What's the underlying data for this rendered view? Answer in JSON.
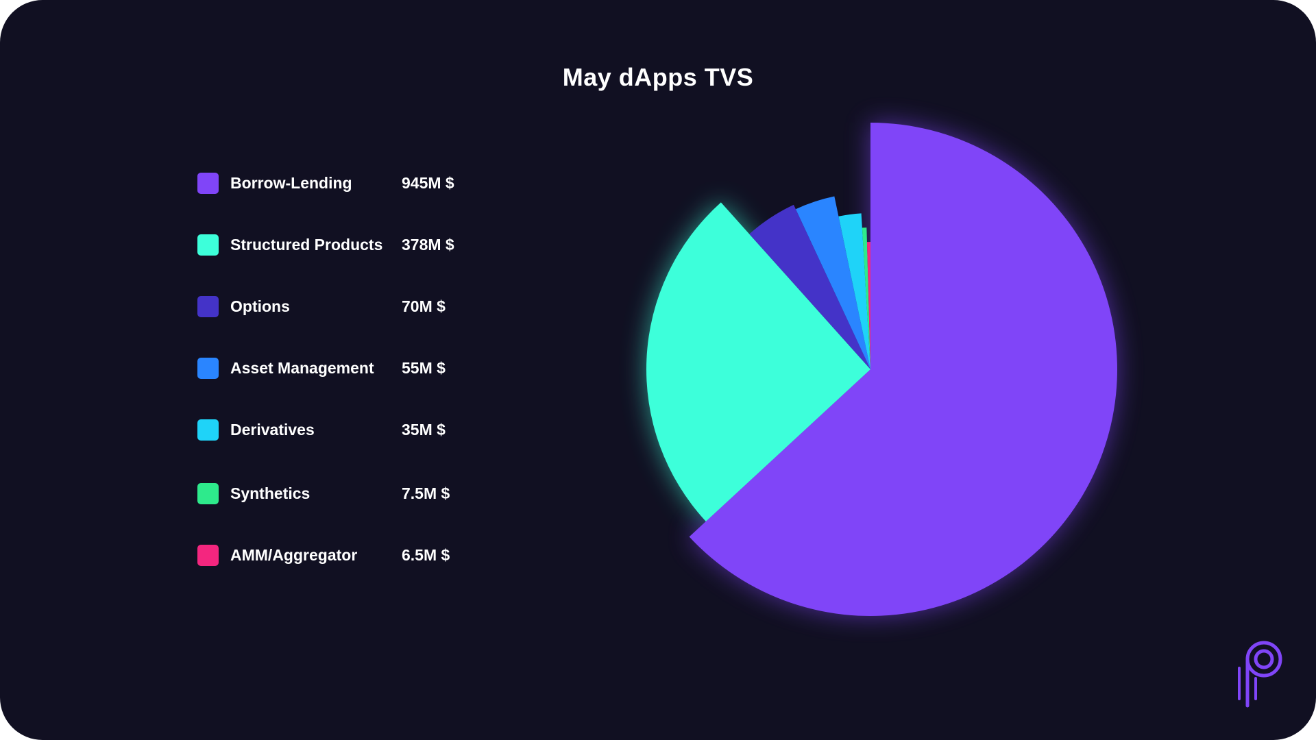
{
  "chart_data": {
    "type": "pie",
    "title": "May dAppps TVS",
    "title_display": "May dApps TVS",
    "legend_placement": "left",
    "slices": [
      {
        "label": "Borrow-Lending",
        "value": 945,
        "value_label": "945M $",
        "color": "#8045F8"
      },
      {
        "label": "Structured Products",
        "value": 378,
        "value_label": "378M $",
        "color": "#3DFFDA"
      },
      {
        "label": "Options",
        "value": 70,
        "value_label": "70M $",
        "color": "#4433C8"
      },
      {
        "label": "Asset Management",
        "value": 55,
        "value_label": "55M $",
        "color": "#2A85FF"
      },
      {
        "label": "Derivatives",
        "value": 35,
        "value_label": "35M $",
        "color": "#1FD3F8"
      },
      {
        "label": "Synthetics",
        "value": 7.5,
        "value_label": "7.5M $",
        "color": "#2EEA8C"
      },
      {
        "label": "AMM/Aggregator",
        "value": 6.5,
        "value_label": "6.5M $",
        "color": "#F4267F"
      }
    ]
  },
  "colors": {
    "background": "#111022",
    "text": "#ffffff",
    "logo": "#8045F8"
  },
  "icons": {
    "logo": "brand-logo-icon"
  }
}
